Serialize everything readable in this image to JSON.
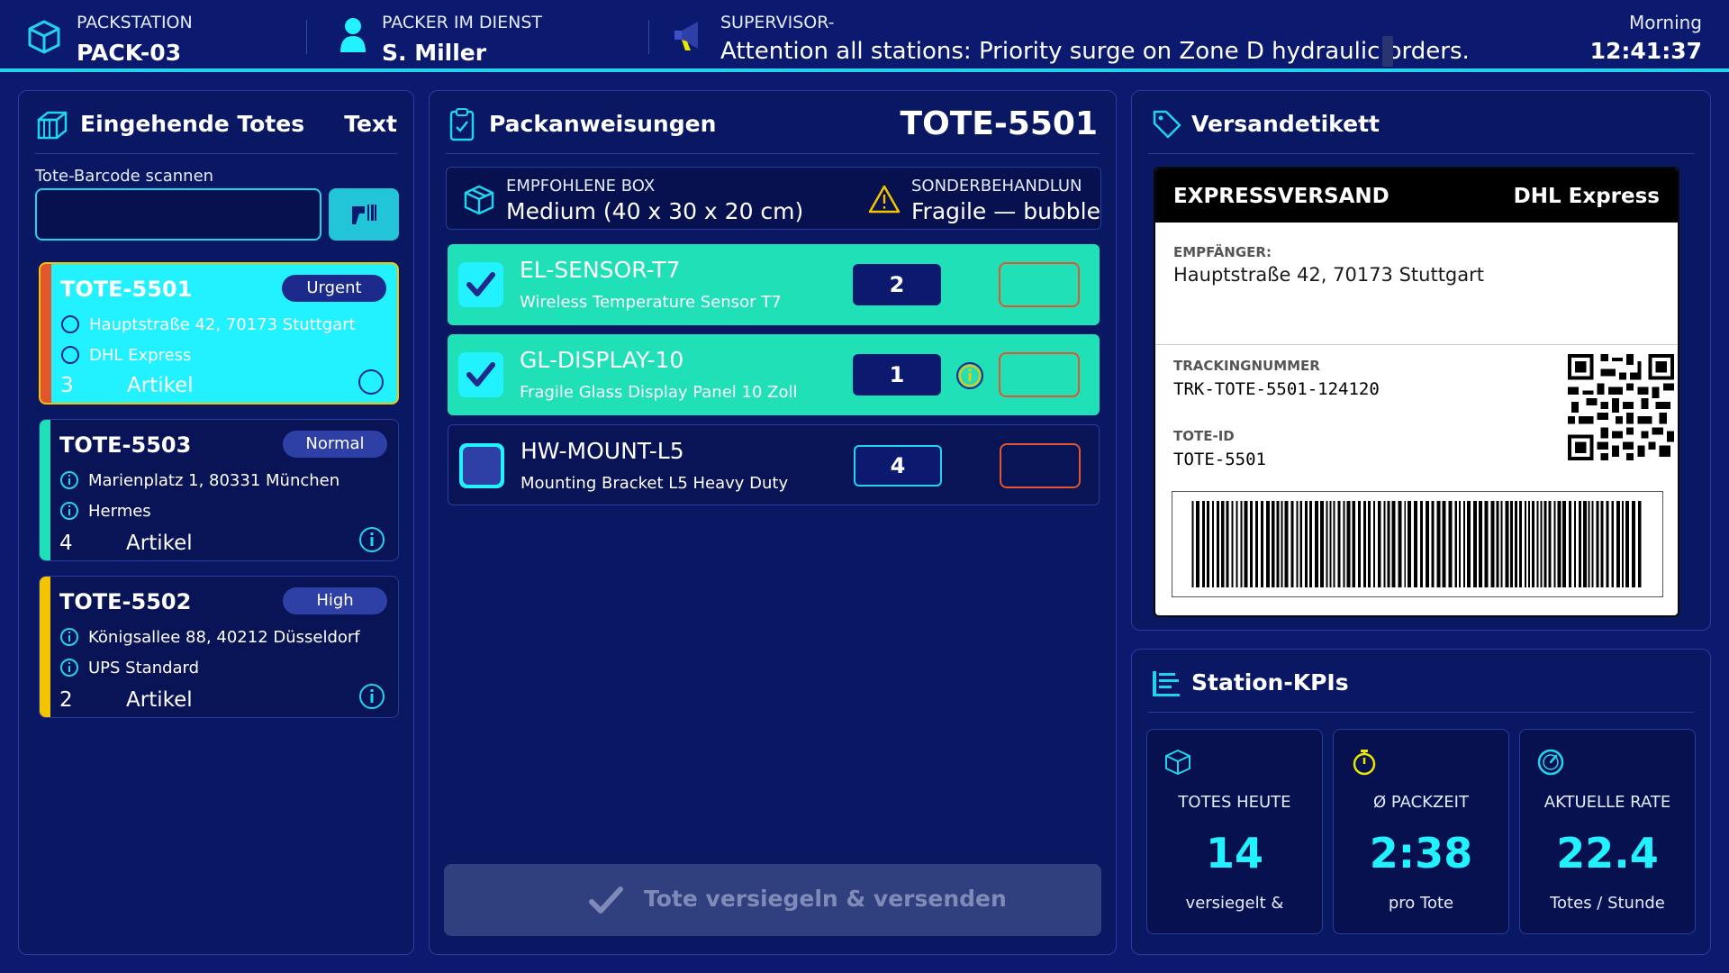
{
  "header": {
    "station_label": "PACKSTATION",
    "station_value": "PACK-03",
    "packer_label": "PACKER IM DIENST",
    "packer_value": "S. Miller",
    "supervisor_label": "SUPERVISOR-",
    "announcement": "Attention all stations: Priority surge on Zone D hydraulic orders.",
    "greeting": "Morning",
    "time": "12:41:37"
  },
  "incoming": {
    "title": "Eingehende Totes",
    "header_link": "Text",
    "scan_label": "Tote-Barcode scannen",
    "scan_value": "",
    "totes": [
      {
        "id": "TOTE-5501",
        "priority": "Urgent",
        "address": "Hauptstraße 42, 70173 Stuttgart",
        "carrier": "DHL Express",
        "count": "3",
        "items_label": "Artikel",
        "bar_color": "#e2562e"
      },
      {
        "id": "TOTE-5503",
        "priority": "Normal",
        "address": "Marienplatz 1, 80331 München",
        "carrier": "Hermes",
        "count": "4",
        "items_label": "Artikel",
        "bar_color": "#20e0b8"
      },
      {
        "id": "TOTE-5502",
        "priority": "High",
        "address": "Königsallee 88, 40212 Düsseldorf",
        "carrier": "UPS Standard",
        "count": "2",
        "items_label": "Artikel",
        "bar_color": "#f5c400"
      }
    ]
  },
  "instructions": {
    "title": "Packanweisungen",
    "tote_id": "TOTE-5501",
    "box_label": "EMPFOHLENE BOX",
    "box_value": "Medium (40 x 30 x 20 cm)",
    "special_label": "SONDERBEHANDLUN",
    "special_value": "Fragile — bubble",
    "items": [
      {
        "sku": "EL-SENSOR-T7",
        "description": "Wireless Temperature Sensor T7",
        "qty": "2",
        "done": true
      },
      {
        "sku": "GL-DISPLAY-10",
        "description": "Fragile Glass Display Panel 10 Zoll",
        "qty": "1",
        "done": true
      },
      {
        "sku": "HW-MOUNT-L5",
        "description": "Mounting Bracket L5 Heavy Duty",
        "qty": "4",
        "done": false
      }
    ],
    "seal_button": "Tote versiegeln & versenden"
  },
  "label": {
    "title": "Versandetikett",
    "service": "EXPRESSVERSAND",
    "carrier": "DHL Express",
    "recipient_label": "EMPFÄNGER:",
    "recipient_value": "Hauptstraße 42, 70173 Stuttgart",
    "tracking_label": "TRACKINGNUMMER",
    "tracking_value": "TRK-TOTE-5501-124120",
    "tote_label": "TOTE-ID",
    "tote_value": "TOTE-5501"
  },
  "kpis": {
    "title": "Station-KPIs",
    "cards": [
      {
        "title": "TOTES HEUTE",
        "value": "14",
        "sub": "versiegelt &"
      },
      {
        "title": "Ø PACKZEIT",
        "value": "2:38",
        "sub": "pro Tote"
      },
      {
        "title": "AKTUELLE RATE",
        "value": "22.4",
        "sub": "Totes / Stunde"
      }
    ]
  },
  "colors": {
    "background": "#0b1a6e",
    "accent": "#22d3ee",
    "success": "#20e0b8",
    "urgent": "#e2562e",
    "high": "#f5c400"
  }
}
